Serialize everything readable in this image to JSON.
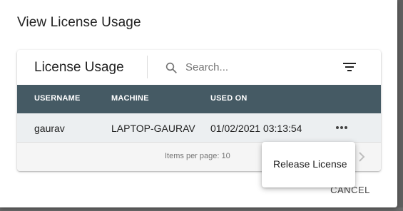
{
  "dialog": {
    "title": "View License Usage",
    "cancel_label": "CANCEL"
  },
  "card": {
    "title": "License Usage",
    "search": {
      "placeholder": "Search...",
      "value": ""
    }
  },
  "table": {
    "columns": [
      "USERNAME",
      "MACHINE",
      "USED ON"
    ],
    "rows": [
      {
        "username": "gaurav",
        "machine": "LAPTOP-GAURAV",
        "used_on": "01/02/2021 03:13:54"
      }
    ]
  },
  "paginator": {
    "items_per_page_label": "Items per page: 10"
  },
  "context_menu": {
    "items": [
      {
        "label": "Release License"
      }
    ]
  },
  "colors": {
    "table_header_bg": "#455a64",
    "row_bg": "#eceff1",
    "paginator_bg": "#f5f5f5"
  },
  "icons": [
    "search-icon",
    "filter-icon",
    "more-horizontal-icon",
    "chevron-right-icon"
  ]
}
